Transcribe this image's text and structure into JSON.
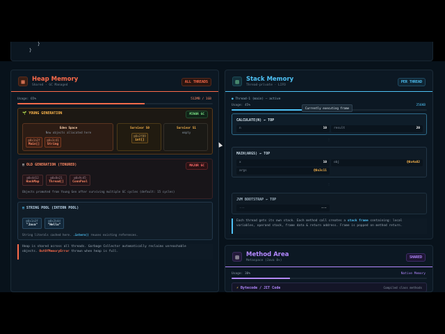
{
  "code_tail": {
    "line1": "}",
    "line2": "}"
  },
  "heap": {
    "icon": "chip-icon",
    "title": "Heap Memory",
    "subtitle": "Shared · GC Managed",
    "badge": "ALL THREADS",
    "usage_label": "Usage: 65%",
    "usage_value": "512MB / 1GB",
    "usage_fraction": 0.65,
    "young": {
      "title": "YOUNG GENERATION",
      "badge": "MINOR GC",
      "eden_title": "Eden Space",
      "eden_sub": "New objects allocated here",
      "eden_objects": [
        {
          "addr": "@0x1a2f",
          "type": "Main[]"
        },
        {
          "addr": "@0x3c41",
          "type": "String"
        }
      ],
      "s0_title": "Survivor S0",
      "s0_object": {
        "addr": "@0x2f89",
        "type": "int[]"
      },
      "s1_title": "Survivor S1",
      "s1_sub": "empty"
    },
    "old": {
      "title": "OLD GENERATION (TENURED)",
      "badge": "MAJOR GC",
      "objects": [
        {
          "addr": "@0x4d12",
          "type": "HashMap"
        },
        {
          "addr": "@0x8e21",
          "type": "Thread[]"
        },
        {
          "addr": "@0x9c45",
          "type": "ConnPool"
        }
      ],
      "note": "Objects promoted from Young Gen after surviving multiple GC cycles (default: 15 cycles)"
    },
    "pool": {
      "title": "STRING POOL (INTERN POOL)",
      "objects": [
        {
          "addr": "@0x1a3f",
          "type": "\"Java\""
        },
        {
          "addr": "@0x2b4d",
          "type": "\"Hello\""
        }
      ],
      "note_a": "String literals cached here. ",
      "note_code": ".intern()",
      "note_b": " reuses existing references."
    },
    "footer_line1": "Heap is shared across all threads. Garbage Collector automatically reclaims unreachable",
    "footer_a": "objects. ",
    "footer_err": "OutOfMemoryError",
    "footer_b": " thrown when heap is full."
  },
  "stack": {
    "icon": "layers-icon",
    "title": "Stack Memory",
    "subtitle": "Thread-private · LIFO",
    "badge": "PER THREAD",
    "usage_label": "Usage: 45%",
    "usage_value": "256KB",
    "usage_fraction": 0.45,
    "thread": "Thread-1 (main) — active",
    "tooltip": "Currently executing frame",
    "frames": [
      {
        "title": "CALCULATE(N) ← TOP",
        "cells": [
          [
            "n",
            "10"
          ],
          [
            "result",
            "20"
          ]
        ]
      },
      {
        "title": "MAIN(ARGS) ← TOP",
        "cells": [
          [
            "x",
            "10"
          ],
          [
            "obj",
            "@0x4a82"
          ],
          [
            "args",
            "@0x3c11"
          ]
        ]
      },
      {
        "title": "JVM BOOTSTRAP ← TOP",
        "cells": [
          [
            "...",
            "..."
          ]
        ]
      }
    ],
    "note_a": "Each thread gets its own stack. Each method call creates a ",
    "note_bold": "stack frame",
    "note_b": " containing: local",
    "note_line2": "variables, operand stack, frame data & return address. Frame is popped on method return."
  },
  "method": {
    "icon": "document-icon",
    "title": "Method Area",
    "subtitle": "Metaspace (Java 8+)",
    "badge": "SHARED",
    "usage_label": "Usage: 30%",
    "usage_value": "Native Memory",
    "usage_fraction": 0.3,
    "item_label": "Bytecode / JIT Code",
    "item_value": "Compiled class methods"
  },
  "colors": {
    "heap": "#ff6b4a",
    "stack": "#4fc3f7",
    "method": "#b388ff",
    "young": "#ffb84d",
    "gc_green": "#7ee787"
  }
}
